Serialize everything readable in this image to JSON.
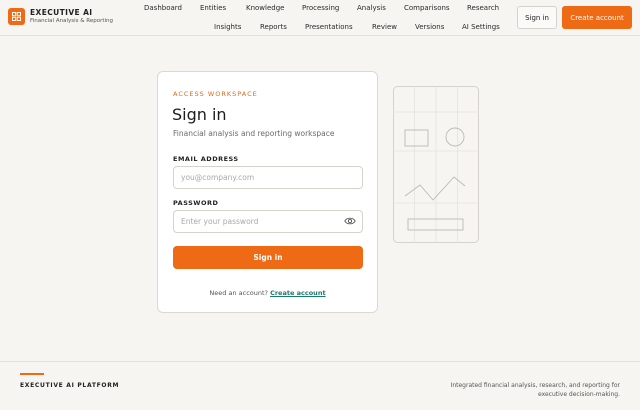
{
  "brand": {
    "name": "EXECUTIVE AI",
    "tagline": "Financial Analysis & Reporting",
    "accent_color": "#ee6a14",
    "logo_icon": "grid-icon"
  },
  "nav": {
    "row1": [
      "Dashboard",
      "Entities",
      "Knowledge",
      "Processing",
      "Analysis",
      "Comparisons",
      "Research"
    ],
    "row2": [
      "Insights",
      "Reports",
      "Presentations",
      "Review",
      "Versions",
      "AI Settings"
    ]
  },
  "header_actions": {
    "signin_label": "Sign in",
    "create_label": "Create account"
  },
  "signin_card": {
    "eyebrow": "ACCESS WORKSPACE",
    "title": "Sign in",
    "subtitle": "Financial analysis and reporting workspace",
    "email_label": "EMAIL ADDRESS",
    "email_value": "",
    "email_placeholder": "you@company.com",
    "password_label": "PASSWORD",
    "password_value": "",
    "password_placeholder": "Enter your password",
    "password_toggle_icon": "eye-icon",
    "submit_label": "Sign in",
    "need_account_text": "Need an account?",
    "create_link": "Create account",
    "link_color": "#1a7a6b"
  },
  "footer": {
    "title": "EXECUTIVE AI PLATFORM",
    "description": "Integrated financial analysis, research, and reporting for executive decision-making."
  }
}
